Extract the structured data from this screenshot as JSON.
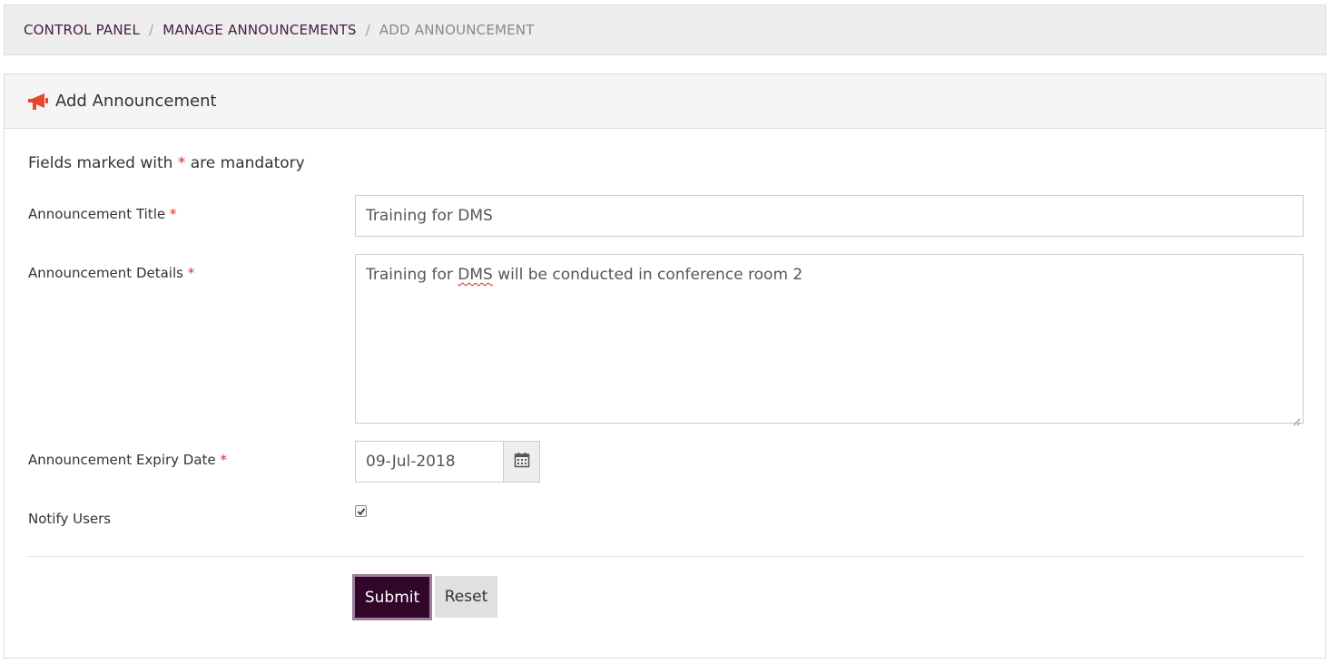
{
  "breadcrumb": {
    "items": [
      {
        "label": "CONTROL PANEL"
      },
      {
        "label": "MANAGE ANNOUNCEMENTS"
      }
    ],
    "current": "ADD ANNOUNCEMENT",
    "separator": "/"
  },
  "panel": {
    "title": "Add Announcement",
    "icon": "bullhorn-icon",
    "icon_color": "#e8472b"
  },
  "form": {
    "mandatory_note_prefix": "Fields marked with",
    "mandatory_note_star": "*",
    "mandatory_note_suffix": "are mandatory",
    "required_star": "*",
    "title_label": "Announcement Title",
    "title_value": "Training for DMS",
    "details_label": "Announcement Details",
    "details_value_before": "Training for ",
    "details_value_flagged": "DMS",
    "details_value_after": " will be conducted in conference room 2",
    "expiry_label": "Announcement Expiry Date",
    "expiry_value": "09-Jul-2018",
    "expiry_icon": "calendar-icon",
    "notify_label": "Notify Users",
    "notify_checked": true
  },
  "actions": {
    "submit_label": "Submit",
    "reset_label": "Reset"
  },
  "colors": {
    "primary_button": "#32052b",
    "required_marker": "#dd2b2b",
    "breadcrumb_link": "#4a1942"
  }
}
